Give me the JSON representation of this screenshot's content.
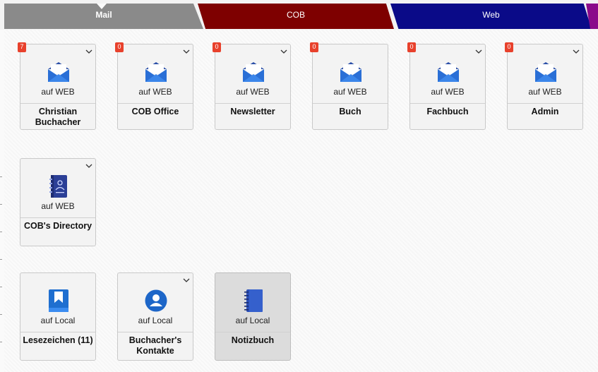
{
  "tabs": [
    {
      "label": "Mail",
      "active": true,
      "color": "#8a8a8a"
    },
    {
      "label": "COB",
      "active": false,
      "color": "#7e0000"
    },
    {
      "label": "Web",
      "active": false,
      "color": "#0a0a88"
    },
    {
      "label": "",
      "active": false,
      "color": "#8a0a8a"
    }
  ],
  "tiles": [
    {
      "name": "Christian Buchacher",
      "sub": "auf WEB",
      "badge": "7",
      "icon": "mail-icon"
    },
    {
      "name": "COB Office",
      "sub": "auf WEB",
      "badge": "0",
      "icon": "mail-icon"
    },
    {
      "name": "Newsletter",
      "sub": "auf WEB",
      "badge": "0",
      "icon": "mail-icon"
    },
    {
      "name": "Buch",
      "sub": "auf WEB",
      "badge": "0",
      "icon": "mail-icon"
    },
    {
      "name": "Fachbuch",
      "sub": "auf WEB",
      "badge": "0",
      "icon": "mail-icon"
    },
    {
      "name": "Admin",
      "sub": "auf WEB",
      "badge": "0",
      "icon": "mail-icon"
    },
    {
      "name": "COB's Directory",
      "sub": "auf WEB",
      "icon": "directory-icon"
    },
    {
      "name": "Lesezeichen (11)",
      "sub": "auf Local",
      "icon": "bookmark-icon"
    },
    {
      "name": "Buchacher's Kontakte",
      "sub": "auf Local",
      "icon": "contact-icon"
    },
    {
      "name": "Notizbuch",
      "sub": "auf Local",
      "icon": "notebook-icon",
      "selected": true
    }
  ],
  "colors": {
    "badge": "#e8412c",
    "icon_blue": "#2a6fd6",
    "icon_dark": "#2b3f96"
  }
}
